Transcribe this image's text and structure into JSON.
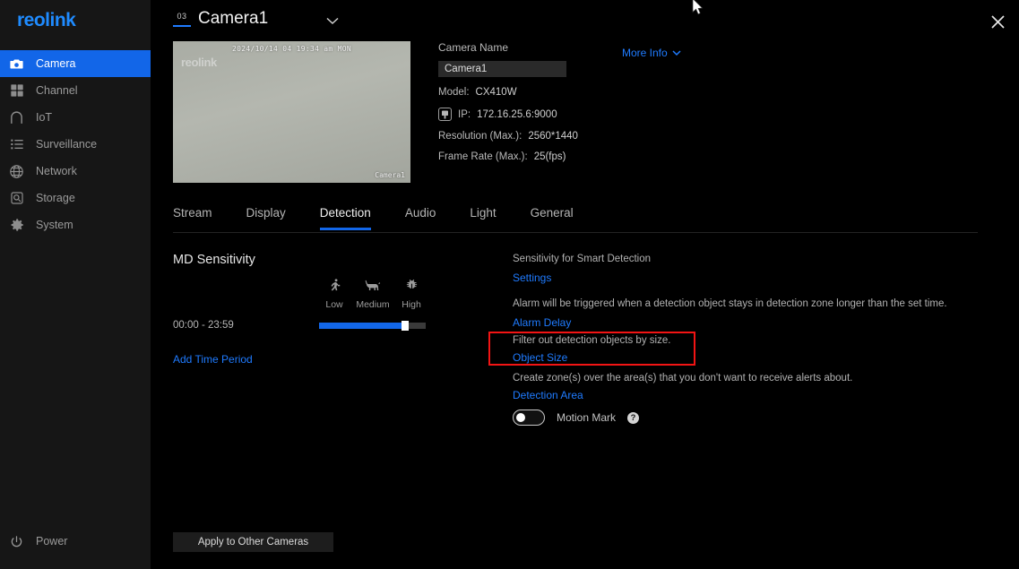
{
  "app": {
    "logo": "reolink"
  },
  "sidebar": {
    "items": [
      {
        "label": "Camera",
        "icon": "camera-icon",
        "active": true
      },
      {
        "label": "Channel",
        "icon": "grid-icon",
        "active": false
      },
      {
        "label": "IoT",
        "icon": "home-icon",
        "active": false
      },
      {
        "label": "Surveillance",
        "icon": "list-icon",
        "active": false
      },
      {
        "label": "Network",
        "icon": "globe-icon",
        "active": false
      },
      {
        "label": "Storage",
        "icon": "hard-drive-icon",
        "active": false
      },
      {
        "label": "System",
        "icon": "gear-icon",
        "active": false
      }
    ],
    "power": {
      "label": "Power",
      "icon": "power-icon"
    }
  },
  "header": {
    "channel_badge": "03",
    "title": "Camera1",
    "dropdown_icon": "chevron-down-icon",
    "close_icon": "close-icon"
  },
  "preview": {
    "timestamp": "2024/10/14 04 19:34 am MON",
    "watermark": "reolink",
    "channel_label": "Camera1"
  },
  "info": {
    "camera_name_label": "Camera Name",
    "camera_name_value": "Camera1",
    "camera_name_placeholder": "Camera Name",
    "more_info_label": "More Info",
    "more_info_icon": "chevron-down-icon",
    "model_label": "Model:",
    "model_value": "CX410W",
    "ip_icon": "ethernet-port-icon",
    "ip_label": "IP:",
    "ip_value": "172.16.25.6:9000",
    "resolution_label": "Resolution (Max.):",
    "resolution_value": "2560*1440",
    "framerate_label": "Frame Rate (Max.):",
    "framerate_value": "25(fps)"
  },
  "tabs": [
    {
      "label": "Stream",
      "active": false
    },
    {
      "label": "Display",
      "active": false
    },
    {
      "label": "Detection",
      "active": true
    },
    {
      "label": "Audio",
      "active": false
    },
    {
      "label": "Light",
      "active": false
    },
    {
      "label": "General",
      "active": false
    }
  ],
  "md": {
    "title": "MD Sensitivity",
    "levels": [
      {
        "label": "Low",
        "icon": "running-person-icon"
      },
      {
        "label": "Medium",
        "icon": "dog-icon"
      },
      {
        "label": "High",
        "icon": "bug-icon"
      }
    ],
    "time_period": "00:00 - 23:59",
    "slider_percent": 78,
    "add_time_period_label": "Add Time Period",
    "apply_button_label": "Apply to Other Cameras"
  },
  "detection": {
    "smart_desc": "Sensitivity for Smart Detection",
    "smart_link": "Settings",
    "alarm_desc": "Alarm will be triggered when a detection object stays in detection zone longer than the set time.",
    "alarm_link": "Alarm Delay",
    "object_desc": "Filter out detection objects by size.",
    "object_link": "Object Size",
    "zone_desc": "Create zone(s) over the area(s) that you don't want to receive alerts about.",
    "zone_link": "Detection Area",
    "motion_mark_label": "Motion Mark",
    "motion_mark_on": false,
    "help_icon_label": "?"
  },
  "colors": {
    "accent_blue": "#1266e8",
    "link_blue": "#1f7bff",
    "highlight_red": "#f21414",
    "sidebar_bg": "#161616",
    "page_bg": "#000000"
  }
}
